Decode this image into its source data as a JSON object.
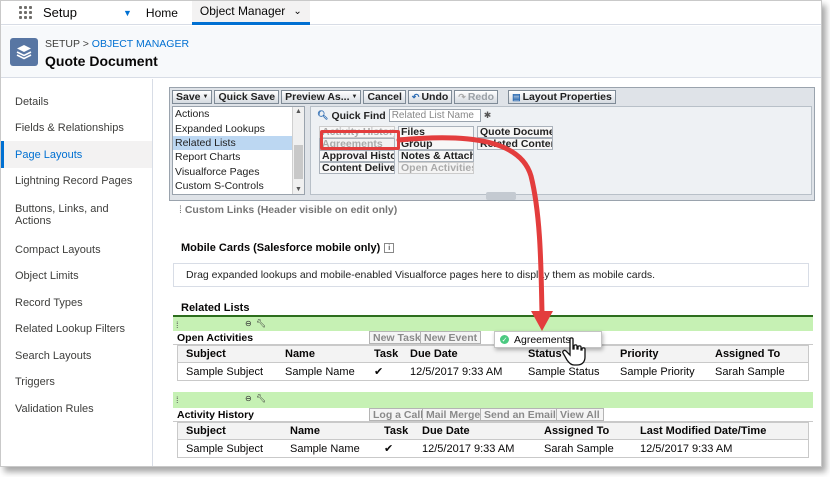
{
  "topnav": {
    "app_name": "Setup",
    "home": "Home",
    "active_tab": "Object Manager"
  },
  "header": {
    "crumb_prefix": "SETUP > ",
    "crumb_link": "OBJECT MANAGER",
    "title": "Quote Document"
  },
  "sidebar": {
    "items": [
      "Details",
      "Fields & Relationships",
      "Page Layouts",
      "Lightning Record Pages",
      "Buttons, Links, and Actions",
      "Compact Layouts",
      "Object Limits",
      "Record Types",
      "Related Lookup Filters",
      "Search Layouts",
      "Triggers",
      "Validation Rules"
    ],
    "active_index": 2
  },
  "toolbar": {
    "save": "Save",
    "quick_save": "Quick Save",
    "preview": "Preview As...",
    "cancel": "Cancel",
    "undo": "Undo",
    "redo": "Redo",
    "layout_properties": "Layout Properties"
  },
  "palette": {
    "categories": [
      "Actions",
      "Expanded Lookups",
      "Related Lists",
      "Report Charts",
      "Visualforce Pages",
      "Custom S-Controls"
    ],
    "selected_category": "Related Lists",
    "quick_find_label": "Quick Find",
    "quick_find_placeholder": "Related List Name",
    "items": {
      "activity_history": "Activity History",
      "files": "Files",
      "quote_documents": "Quote Documents",
      "agreements": "Agreements",
      "group": "Group",
      "related_content": "Related Content",
      "approval_history": "Approval History",
      "notes_attachments": "Notes & Attachments",
      "content_deliveries": "Content Deliveries",
      "open_activities": "Open Activities"
    }
  },
  "layout": {
    "custom_links": "Custom Links",
    "custom_links_note": "(Header visible on edit only)",
    "mobile_cards_title": "Mobile Cards (Salesforce mobile only)",
    "mobile_cards_text": "Drag expanded lookups and mobile-enabled Visualforce pages here to display them as mobile cards.",
    "related_lists_title": "Related Lists"
  },
  "open_activities": {
    "name": "Open Activities",
    "buttons": [
      "New Task",
      "New Event"
    ],
    "columns": [
      "Subject",
      "Name",
      "Task",
      "Due Date",
      "Status",
      "Priority",
      "Assigned To"
    ],
    "row": [
      "Sample Subject",
      "Sample Name",
      "✔",
      "12/5/2017 9:33 AM",
      "Sample Status",
      "Sample Priority",
      "Sarah Sample"
    ]
  },
  "activity_history": {
    "name": "Activity History",
    "buttons": [
      "Log a Call",
      "Mail Merge",
      "Send an Email",
      "View All"
    ],
    "columns": [
      "Subject",
      "Name",
      "Task",
      "Due Date",
      "Assigned To",
      "Last Modified Date/Time"
    ],
    "row": [
      "Sample Subject",
      "Sample Name",
      "✔",
      "12/5/2017 9:33 AM",
      "Sarah Sample",
      "12/5/2017 9:33 AM"
    ]
  },
  "drag": {
    "label": "Agreements"
  },
  "colors": {
    "accent": "#0070d2",
    "highlight": "#e33d3d",
    "section_bar": "#c6f1b4"
  }
}
